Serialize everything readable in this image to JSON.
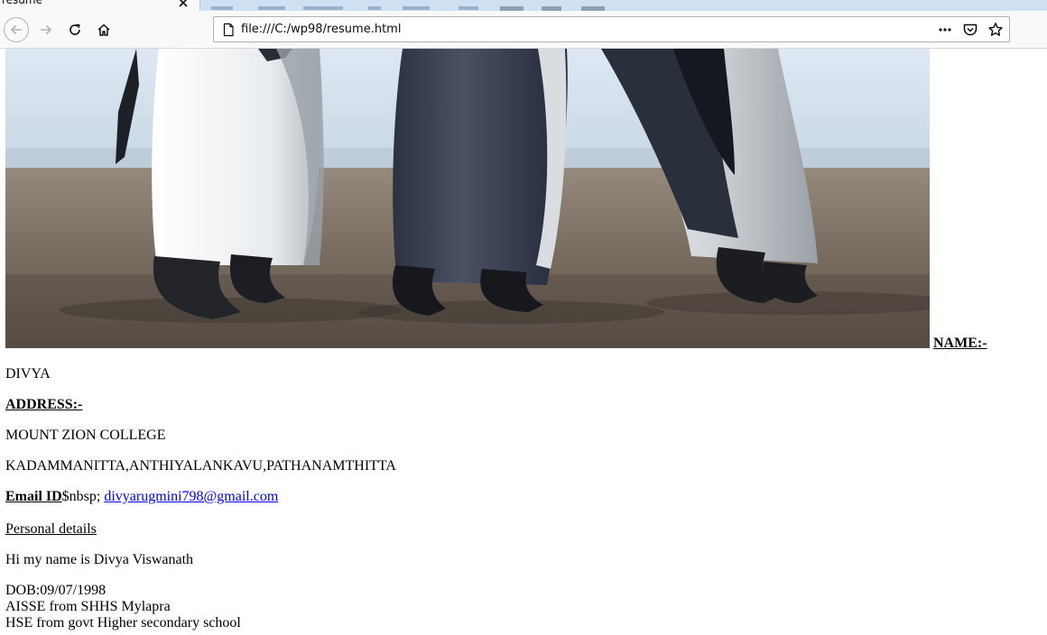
{
  "browser": {
    "tab": {
      "title": "resume"
    },
    "url": "file:///C:/wp98/resume.html"
  },
  "content": {
    "image": {
      "subject": "penguins-on-beach-photo"
    },
    "name_label": "NAME:-",
    "name_value": "DIVYA",
    "address_label": "ADDRESS:-",
    "address_line1": "MOUNT ZION COLLEGE",
    "address_line2": "KADAMMANITTA,ANTHIYALANKAVU,PATHANAMTHITTA",
    "email_label": "Email ID",
    "email_separator": "$nbsp; ",
    "email_value": "divyarugmini798@gmail.com",
    "personal_heading": "Personal details",
    "intro": "Hi my name is Divya Viswanath",
    "dob": "DOB:09/07/1998",
    "education": [
      "AISSE from SHHS Mylapra",
      "HSE from govt Higher secondary school"
    ]
  },
  "colors": {
    "link": "#0000ee",
    "chrome_bg": "#f9f9fa",
    "tabstrip_bg": "#cfe0f2"
  }
}
